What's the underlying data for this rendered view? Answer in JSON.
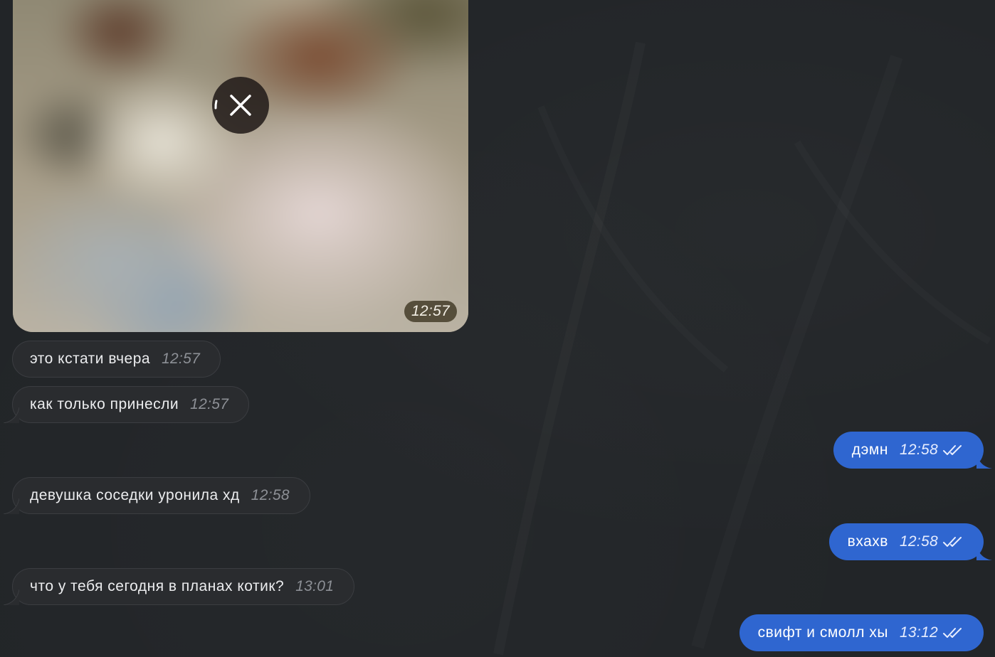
{
  "photo": {
    "time": "12:57",
    "close_icon": "close-icon"
  },
  "messages": [
    {
      "direction": "in",
      "text": "это кстати вчера",
      "time": "12:57"
    },
    {
      "direction": "in",
      "text": "как только принесли",
      "time": "12:57"
    },
    {
      "direction": "out",
      "text": "дэмн",
      "time": "12:58",
      "status_icon": "double-check-icon"
    },
    {
      "direction": "in",
      "text": "девушка соседки уронила хд",
      "time": "12:58"
    },
    {
      "direction": "out",
      "text": "вхахв",
      "time": "12:58",
      "status_icon": "double-check-icon"
    },
    {
      "direction": "in",
      "text": "что у тебя сегодня в планах котик?",
      "time": "13:01"
    },
    {
      "direction": "out",
      "text": "свифт и смолл хы",
      "time": "13:12",
      "status_icon": "double-check-icon"
    }
  ],
  "colors": {
    "background": "#222528",
    "incoming_bubble": "#2a2c2f",
    "outgoing_bubble": "#2f66d0"
  }
}
